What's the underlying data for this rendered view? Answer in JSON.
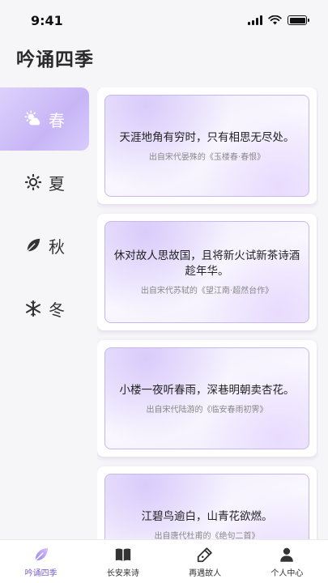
{
  "status_bar": {
    "time": "9:41"
  },
  "header": {
    "title": "吟诵四季"
  },
  "sidebar": {
    "items": [
      {
        "label": "春",
        "icon": "sun-cloud-icon",
        "active": true
      },
      {
        "label": "夏",
        "icon": "sun-icon",
        "active": false
      },
      {
        "label": "秋",
        "icon": "leaf-icon",
        "active": false
      },
      {
        "label": "冬",
        "icon": "snowflake-icon",
        "active": false
      }
    ]
  },
  "poems": [
    {
      "text": "天涯地角有穷时，只有相思无尽处。",
      "source": "出自宋代晏殊的《玉楼春·春恨》"
    },
    {
      "text": "休对故人思故国，且将新火试新茶诗酒趁年华。",
      "source": "出自宋代苏轼的《望江南·超然台作》"
    },
    {
      "text": "小楼一夜听春雨，深巷明朝卖杏花。",
      "source": "出自宋代陆游的《临安春雨初霁》"
    },
    {
      "text": "江碧鸟逾白，山青花欲燃。",
      "source": "出自唐代杜甫的《绝句二首》"
    }
  ],
  "tab_bar": {
    "items": [
      {
        "label": "吟诵四季",
        "icon": "leaf-icon",
        "active": true
      },
      {
        "label": "长安来诗",
        "icon": "book-icon",
        "active": false
      },
      {
        "label": "再遇故人",
        "icon": "pen-icon",
        "active": false
      },
      {
        "label": "个人中心",
        "icon": "person-icon",
        "active": false
      }
    ]
  },
  "colors": {
    "accent": "#7b5fd6",
    "active_bg": "#c7b5f6",
    "card_border": "#c7b7f0"
  }
}
